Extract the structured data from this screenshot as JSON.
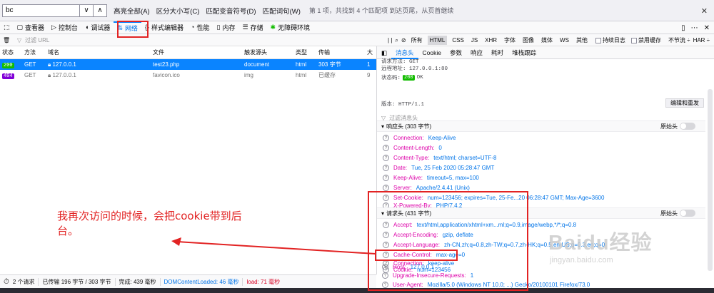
{
  "findbar": {
    "query": "bc",
    "prev_icon": "chevron-down-icon",
    "next_icon": "chevron-up-icon",
    "highlight_all": "高亮全部(A)",
    "match_case": "区分大小写(C)",
    "match_diacritics": "匹配变音符号(D)",
    "whole_words": "匹配词句(W)",
    "status": "第 1 项，共找到 4 个匹配项 到达页尾，从页首继续"
  },
  "devtools": {
    "tabs": [
      {
        "label": "查看器"
      },
      {
        "label": "控制台"
      },
      {
        "label": "调试器"
      },
      {
        "label": "网络"
      },
      {
        "label": "样式编辑器"
      },
      {
        "label": "性能"
      },
      {
        "label": "内存"
      },
      {
        "label": "存储"
      },
      {
        "label": "无障碍环境"
      }
    ]
  },
  "network": {
    "filter_placeholder": "过滤 URL",
    "types": [
      "所有",
      "HTML",
      "CSS",
      "JS",
      "XHR",
      "字体",
      "图像",
      "媒体",
      "WS",
      "其他"
    ],
    "persist_logs": "持续日志",
    "disable_cache": "禁用缓存",
    "throttle": "不节流 ÷",
    "har": "HAR ÷",
    "columns": [
      "状态",
      "方法",
      "域名",
      "文件",
      "触发源头",
      "类型",
      "传输",
      "大"
    ],
    "rows": [
      {
        "status": "200",
        "method": "GET",
        "domain": "127.0.0.1",
        "file": "test23.php",
        "cause": "document",
        "type": "html",
        "transferred": "303 字节",
        "size": "1"
      },
      {
        "status": "404",
        "method": "GET",
        "domain": "127.0.0.1",
        "file": "favicon.ico",
        "cause": "img",
        "type": "html",
        "transferred": "已缓存",
        "size": "9"
      }
    ]
  },
  "details": {
    "tabs": [
      "消息头",
      "Cookie",
      "参数",
      "响应",
      "耗时",
      "堆栈跟踪"
    ],
    "request_method_partial": "请求方法: GET",
    "remote_address": "远程地址: 127.0.0.1:80",
    "status_code_label": "状态码:",
    "status_code": "200",
    "status_text": "OK",
    "version": "版本: HTTP/1.1",
    "filter_headers": "过滤消息头",
    "edit_resend": "编辑和重发",
    "raw_headers": "原始头",
    "response_section": "响应头 (303 字节)",
    "response_headers": [
      {
        "name": "Connection:",
        "value": "Keep-Alive"
      },
      {
        "name": "Content-Length:",
        "value": "0"
      },
      {
        "name": "Content-Type:",
        "value": "text/html; charset=UTF-8"
      },
      {
        "name": "Date:",
        "value": "Tue, 25 Feb 2020 05:28:47 GMT"
      },
      {
        "name": "Keep-Alive:",
        "value": "timeout=5, max=100"
      },
      {
        "name": "Server:",
        "value": "Apache/2.4.41 (Unix)"
      },
      {
        "name": "Set-Cookie:",
        "value": "num=123456; expires=Tue, 25-Fe...20 06:28:47 GMT; Max-Age=3600"
      },
      {
        "name": "X-Powered-By:",
        "value": "PHP/7.4.2"
      }
    ],
    "request_section": "请求头 (431 字节)",
    "request_headers": [
      {
        "name": "Accept:",
        "value": "text/html,application/xhtml+xm...ml;q=0.9,image/webp,*/*;q=0.8"
      },
      {
        "name": "Accept-Encoding:",
        "value": "gzip, deflate"
      },
      {
        "name": "Accept-Language:",
        "value": "zh-CN,zh;q=0.8,zh-TW;q=0.7,zh-HK;q=0.5,en-US;q=0.3,en;q=0"
      },
      {
        "name": "Cache-Control:",
        "value": "max-age=0"
      },
      {
        "name": "Connection:",
        "value": "keep-alive"
      },
      {
        "name": "Cookie:",
        "value": "num=123456"
      },
      {
        "name": "Host:",
        "value": "127.0.0.1"
      },
      {
        "name": "Upgrade-Insecure-Requests:",
        "value": "1"
      },
      {
        "name": "User-Agent:",
        "value": "Mozilla/5.0 (Windows NT 10.0; ...) Gecko/20100101 Firefox/73.0"
      }
    ]
  },
  "statusbar": {
    "requests": "2 个请求",
    "transferred": "已传输 196 字节 / 303 字节",
    "finish": "完成: 439 毫秒",
    "dom_loaded": "DOMContentLoaded: 46 毫秒",
    "load": "load: 71 毫秒"
  },
  "annotation": {
    "text": "我再次访问的时候，会把cookie带到后台。",
    "color": "#e22323"
  },
  "watermark": {
    "logo": "Baidu经验",
    "url": "jingyan.baidu.com"
  },
  "colors": {
    "accent": "#0a84ff",
    "header_name": "#dd00a9",
    "header_value": "#0074e8",
    "status_ok": "#12bc00",
    "status_cached": "#8000d7"
  }
}
